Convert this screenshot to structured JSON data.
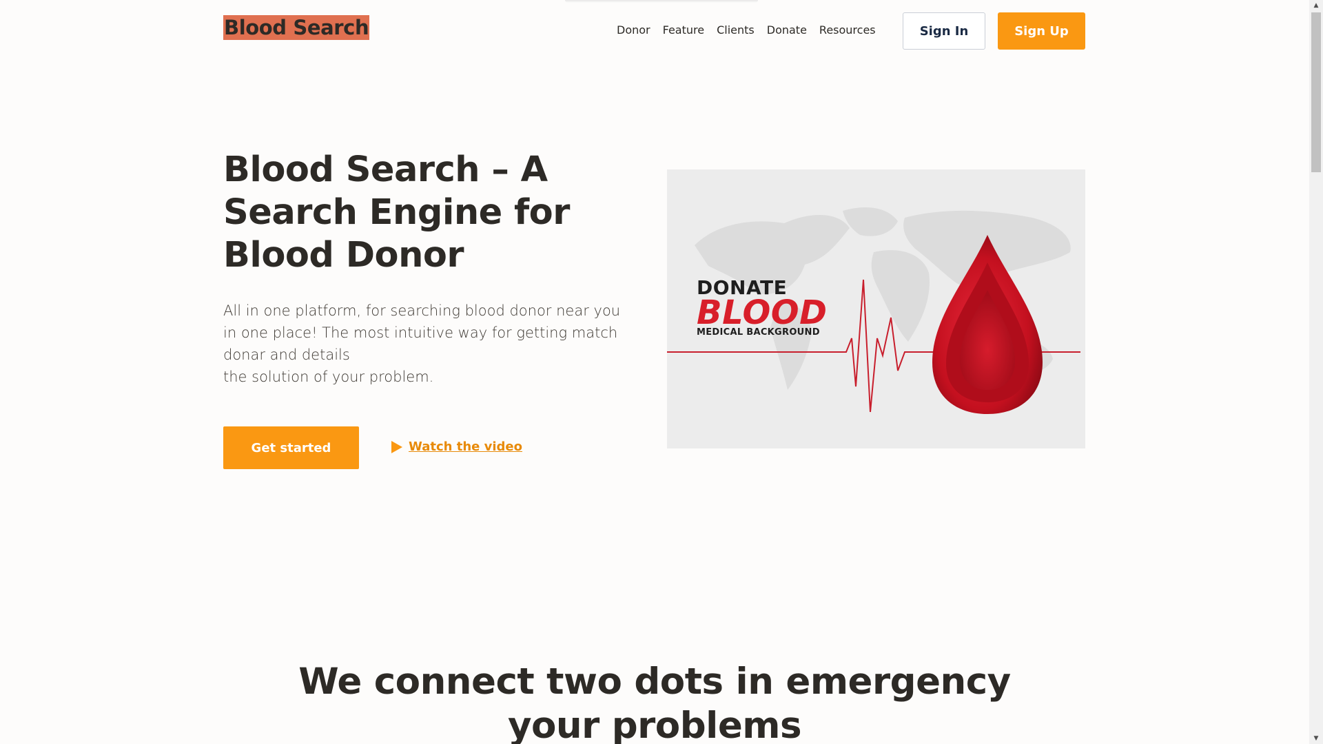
{
  "header": {
    "logo": "Blood Search",
    "nav": [
      "Donor",
      "Feature",
      "Clients",
      "Donate",
      "Resources"
    ],
    "sign_in": "Sign In",
    "sign_up": "Sign Up"
  },
  "hero": {
    "title": "Blood Search – A Search Engine for Blood Donor",
    "description_lines": [
      "All in one platform, for searching blood donor near you in one place! The most intuitive way for getting match donar and details",
      "the solution of your problem."
    ],
    "cta_primary": "Get started",
    "cta_video": "Watch the video",
    "image": {
      "line1": "DONATE",
      "line2": "BLOOD",
      "line3": "MEDICAL BACKGROUND"
    }
  },
  "section2": {
    "title": "We connect two dots in emergency your problems"
  },
  "colors": {
    "accent": "#fa9812",
    "logo_highlight": "#e07050",
    "blood_red": "#d81f2a",
    "text_dark": "#2d2a26"
  },
  "icons": {
    "play": "play-icon"
  }
}
